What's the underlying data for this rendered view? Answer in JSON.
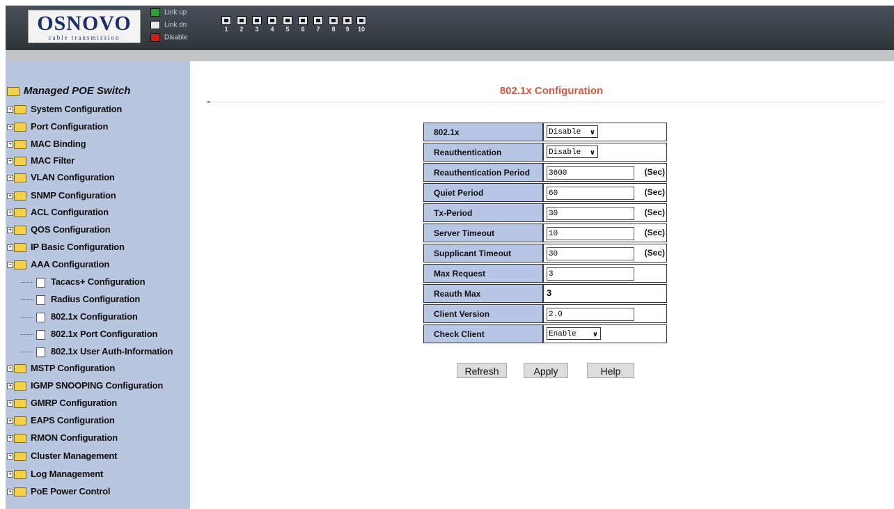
{
  "header": {
    "logo_name": "OSNOVO",
    "logo_sub": "cable transmission",
    "legend": [
      {
        "label": "Link up",
        "color": "#2e9e3c"
      },
      {
        "label": "Link dn",
        "color": "#e8e8e8"
      },
      {
        "label": "Disable",
        "color": "#c0261f"
      }
    ],
    "ports": [
      "1",
      "2",
      "3",
      "4",
      "5",
      "6",
      "7",
      "8",
      "9",
      "10"
    ]
  },
  "sidebar": {
    "root": "Managed POE Switch",
    "items": [
      {
        "label": "System Configuration"
      },
      {
        "label": "Port Configuration"
      },
      {
        "label": "MAC Binding"
      },
      {
        "label": "MAC Filter"
      },
      {
        "label": "VLAN Configuration"
      },
      {
        "label": "SNMP Configuration"
      },
      {
        "label": "ACL Configuration"
      },
      {
        "label": "QOS Configuration"
      },
      {
        "label": "IP Basic Configuration"
      },
      {
        "label": "AAA Configuration"
      },
      {
        "label": "MSTP Configuration"
      },
      {
        "label": "IGMP SNOOPING Configuration"
      },
      {
        "label": "GMRP Configuration"
      },
      {
        "label": "EAPS Configuration"
      },
      {
        "label": "RMON Configuration"
      },
      {
        "label": "Cluster Management"
      },
      {
        "label": "Log Management"
      },
      {
        "label": "PoE Power Control"
      }
    ],
    "aaa_children": [
      {
        "label": "Tacacs+ Configuration"
      },
      {
        "label": "Radius Configuration"
      },
      {
        "label": "802.1x Configuration"
      },
      {
        "label": "802.1x Port Configuration"
      },
      {
        "label": "802.1x User Auth-Information"
      }
    ]
  },
  "main": {
    "title": "802.1x Configuration",
    "rows": [
      {
        "label": "802.1x",
        "kind": "select",
        "value": "Disable"
      },
      {
        "label": "Reauthentication",
        "kind": "select",
        "value": "Disable"
      },
      {
        "label": "Reauthentication Period",
        "kind": "input",
        "value": "3600",
        "unit": "(Sec)"
      },
      {
        "label": "Quiet Period",
        "kind": "input",
        "value": "60",
        "unit": "(Sec)"
      },
      {
        "label": "Tx-Period",
        "kind": "input",
        "value": "30",
        "unit": "(Sec)"
      },
      {
        "label": "Server Timeout",
        "kind": "input",
        "value": "10",
        "unit": "(Sec)"
      },
      {
        "label": "Supplicant Timeout",
        "kind": "input",
        "value": "30",
        "unit": "(Sec)"
      },
      {
        "label": "Max Request",
        "kind": "input",
        "value": "3"
      },
      {
        "label": "Reauth Max",
        "kind": "text",
        "value": "3"
      },
      {
        "label": "Client Version",
        "kind": "input",
        "value": "2.0"
      },
      {
        "label": "Check Client",
        "kind": "select",
        "value": "Enable"
      }
    ],
    "buttons": {
      "refresh": "Refresh",
      "apply": "Apply",
      "help": "Help"
    }
  }
}
